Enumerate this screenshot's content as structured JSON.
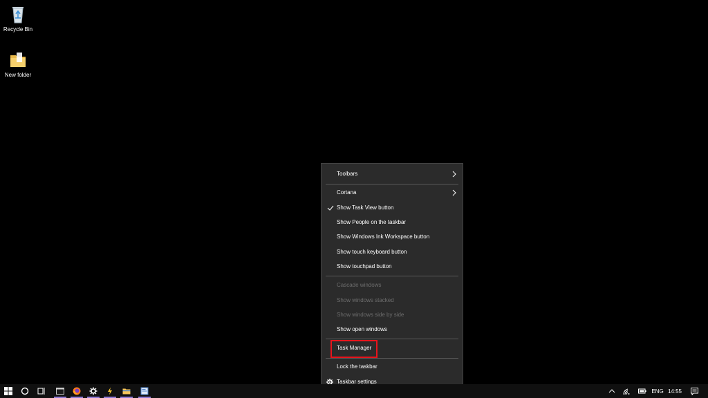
{
  "desktop": {
    "icons": [
      {
        "label": "Recycle Bin",
        "icon": "recycle-bin-icon"
      },
      {
        "label": "New folder",
        "icon": "folder-icon"
      }
    ]
  },
  "context_menu": {
    "items": [
      {
        "label": "Toolbars",
        "submenu": true
      },
      {
        "label": "Cortana",
        "submenu": true
      },
      {
        "label": "Show Task View button",
        "checked": true
      },
      {
        "label": "Show People on the taskbar"
      },
      {
        "label": "Show Windows Ink Workspace button"
      },
      {
        "label": "Show touch keyboard button"
      },
      {
        "label": "Show touchpad button"
      },
      {
        "label": "Cascade windows",
        "disabled": true
      },
      {
        "label": "Show windows stacked",
        "disabled": true
      },
      {
        "label": "Show windows side by side",
        "disabled": true
      },
      {
        "label": "Show open windows"
      },
      {
        "label": "Task Manager",
        "highlighted": true
      },
      {
        "label": "Lock the taskbar"
      },
      {
        "label": "Taskbar settings",
        "icon": "gear-icon"
      }
    ]
  },
  "taskbar": {
    "apps": [
      "terminal-icon",
      "firefox-icon",
      "settings-gear-icon",
      "code-editor-icon",
      "file-explorer-icon",
      "document-viewer-icon"
    ],
    "tray": {
      "language": "ENG",
      "time": "14:55"
    }
  },
  "colors": {
    "menu_bg": "#2b2b2b",
    "highlight": "#e8141c",
    "taskbar_bg": "#101010",
    "app_indicator": "#8f79d4"
  }
}
